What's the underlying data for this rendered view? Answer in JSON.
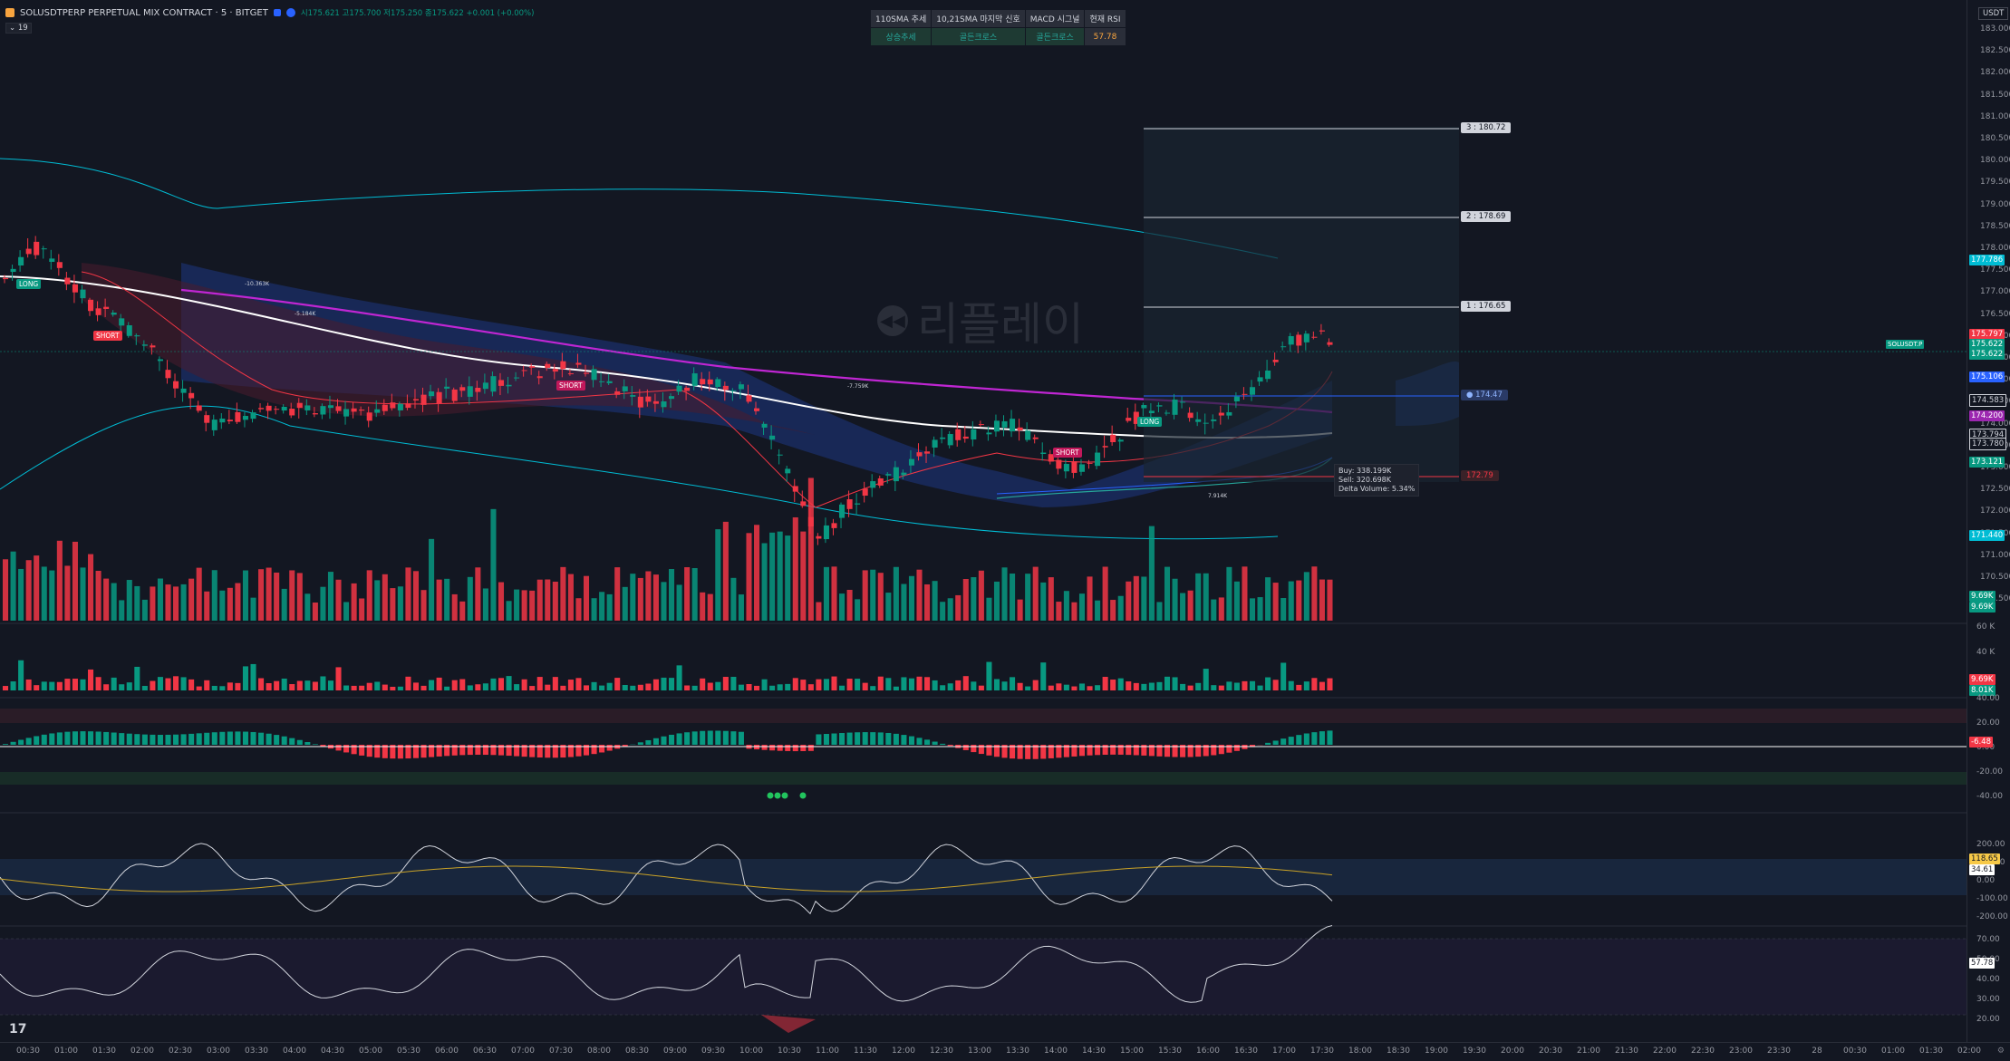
{
  "header": {
    "symbol_title": "SOLUSDTPERP PERPETUAL MIX CONTRACT · 5 · BITGET",
    "ohlc": "시175.621 고175.700 저175.250 종175.622 +0.001 (+0.00%)",
    "interval_indicator": "⌄ 19",
    "currency": "USDT"
  },
  "signal_table": {
    "headers": [
      "110SMA 추세",
      "10,21SMA 마지막 신호",
      "MACD 시그널",
      "현재 RSI"
    ],
    "values": [
      "상승추세",
      "골든크로스",
      "골든크로스",
      "57.78"
    ]
  },
  "watermark_text": "리플레이",
  "targets": [
    {
      "label": "3 : 180.72"
    },
    {
      "label": "2 : 178.69"
    },
    {
      "label": "1 : 176.65"
    }
  ],
  "entry_tag": "174.47",
  "stop_tag": "172.79",
  "signals": {
    "long1": "LONG",
    "short1": "SHORT",
    "short2": "SHORT",
    "long2": "LONG",
    "short3": "SHORT",
    "vol_note1": "-10.363K",
    "vol_note2": "-5.184K",
    "vol_note3": "-7.759K",
    "vol_note4": "7.914K"
  },
  "tooltip": {
    "buy": "Buy: 338.199K",
    "sell": "Sell: 320.698K",
    "delta": "Delta Volume: 5.34%"
  },
  "price_axis": {
    "ticks": [
      "183.000",
      "182.500",
      "182.000",
      "181.500",
      "181.000",
      "180.500",
      "180.000",
      "179.500",
      "179.000",
      "178.500",
      "178.000",
      "177.500",
      "177.000",
      "176.500",
      "176.000",
      "175.500",
      "175.000",
      "174.500",
      "174.000",
      "173.500",
      "173.000",
      "172.500",
      "172.000",
      "171.500",
      "171.000",
      "170.500",
      "169.500"
    ],
    "tags": [
      {
        "text": "177.786",
        "color": "#00bcd4"
      },
      {
        "text": "175.797",
        "color": "#f23645"
      },
      {
        "text": "175.622",
        "color": "#089981"
      },
      {
        "text": "175.622",
        "color": "#089981"
      },
      {
        "text": "SOLUSDT.P",
        "color": "#089981"
      },
      {
        "text": "175.106",
        "color": "#2962ff"
      },
      {
        "text": "174.583",
        "color": "#131722"
      },
      {
        "text": "174.200",
        "color": "#9c27b0"
      },
      {
        "text": "173.794",
        "color": "#131722"
      },
      {
        "text": "173.780",
        "color": "#131722"
      },
      {
        "text": "173.121",
        "color": "#089981"
      },
      {
        "text": "171.440",
        "color": "#00bcd4"
      },
      {
        "text": "9.69K",
        "color": "#089981"
      },
      {
        "text": "9.69K",
        "color": "#089981"
      }
    ],
    "vol_ticks": [
      "60 K",
      "40 K"
    ],
    "vol_tags": [
      {
        "text": "9.69K",
        "color": "#f23645"
      },
      {
        "text": "8.01K",
        "color": "#089981"
      }
    ],
    "osc_ticks": [
      "40.00",
      "20.00",
      "0.00",
      "-20.00",
      "-40.00"
    ],
    "osc_tag": {
      "text": "-6.48",
      "color": "#f23645"
    },
    "cci_ticks": [
      "200.00",
      "100.00",
      "0.00",
      "-100.00",
      "-200.00"
    ],
    "cci_tags": [
      {
        "text": "118.65",
        "color": "#f7c948"
      },
      {
        "text": "34.61",
        "color": "#ffffff"
      }
    ],
    "rsi_ticks": [
      "70.00",
      "50.00",
      "40.00",
      "30.00",
      "20.00"
    ],
    "rsi_tag": {
      "text": "57.78",
      "color": "#ffffff"
    }
  },
  "time_axis": [
    "00:30",
    "01:00",
    "01:30",
    "02:00",
    "02:30",
    "03:00",
    "03:30",
    "04:00",
    "04:30",
    "05:00",
    "05:30",
    "06:00",
    "06:30",
    "07:00",
    "07:30",
    "08:00",
    "08:30",
    "09:00",
    "09:30",
    "10:00",
    "10:30",
    "11:00",
    "11:30",
    "12:00",
    "12:30",
    "13:00",
    "13:30",
    "14:00",
    "14:30",
    "15:00",
    "15:30",
    "16:00",
    "16:30",
    "17:00",
    "17:30",
    "18:00",
    "18:30",
    "19:00",
    "19:30",
    "20:00",
    "20:30",
    "21:00",
    "21:30",
    "22:00",
    "22:30",
    "23:00",
    "23:30",
    "28",
    "00:30",
    "01:00",
    "01:30",
    "02:00"
  ],
  "tv_logo": "17",
  "colors": {
    "up": "#089981",
    "down": "#f23645",
    "bg": "#131722"
  }
}
